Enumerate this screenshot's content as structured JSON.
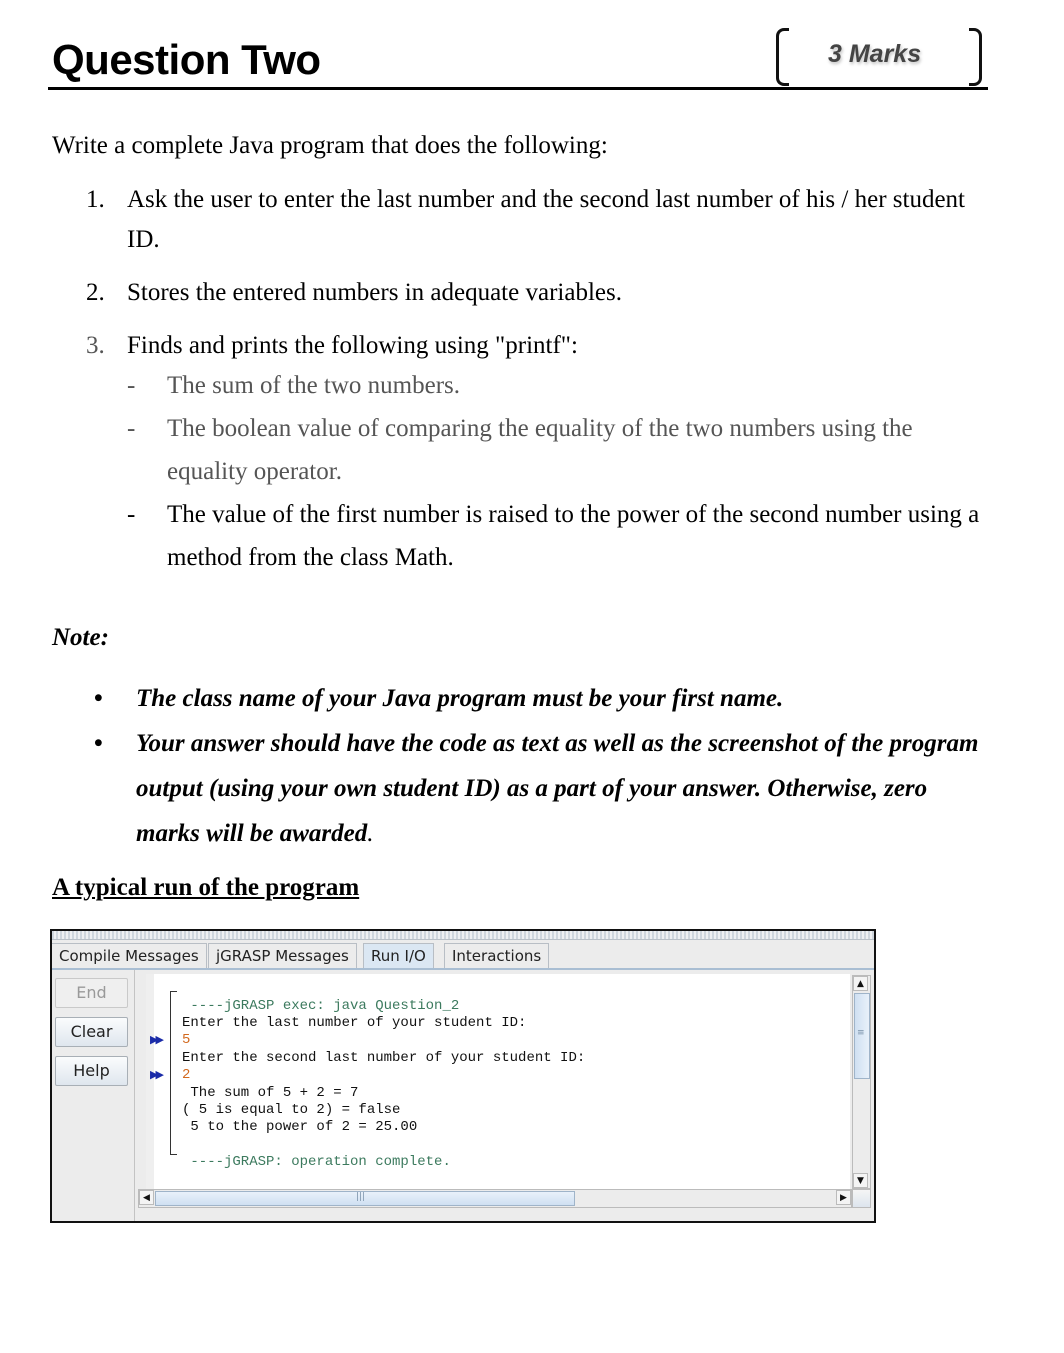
{
  "header": {
    "title": "Question Two",
    "marks": "3 Marks"
  },
  "intro": "Write a complete Java program that does the following:",
  "tasks": [
    {
      "number": "1.",
      "text": "Ask the user to enter the last number and the second last number of his / her student ID."
    },
    {
      "number": "2.",
      "text": "Stores the entered numbers in adequate variables."
    },
    {
      "number": "3.",
      "text": "Finds and prints the following using \"printf\":",
      "subitems": [
        {
          "marker": "-",
          "text": "The sum of the two numbers."
        },
        {
          "marker": "-",
          "text": "The boolean value of comparing the equality of the two numbers using the equality operator."
        },
        {
          "marker": "-",
          "text": "The value of the first number is raised to the power of the second number using a method from the class Math."
        }
      ]
    }
  ],
  "note": {
    "label": "Note:",
    "items": [
      {
        "bullet": "•",
        "text": "The class name of your Java program must be your first name."
      },
      {
        "bullet": "•",
        "text": "Your answer should have the code as text as well as the screenshot of the program output (using your own student ID) as a part of your answer. Otherwise, zero marks will be awarded",
        "end": "."
      }
    ]
  },
  "run_heading": "A typical run of the program",
  "jgrasp": {
    "tabs": [
      {
        "label": "Compile Messages",
        "active": false
      },
      {
        "label": "jGRASP Messages",
        "active": false
      },
      {
        "label": "Run I/O",
        "active": true
      },
      {
        "label": "Interactions",
        "active": false
      }
    ],
    "buttons": {
      "end": "End",
      "clear": "Clear",
      "help": "Help"
    },
    "console_lines": [
      {
        "text": " ----jGRASP exec: java Question_2",
        "kind": "sys"
      },
      {
        "text": "Enter the last number of your student ID:",
        "kind": "out"
      },
      {
        "text": "5",
        "kind": "input"
      },
      {
        "text": "Enter the second last number of your student ID:",
        "kind": "out"
      },
      {
        "text": "2",
        "kind": "input"
      },
      {
        "text": " The sum of 5 + 2 = 7",
        "kind": "out"
      },
      {
        "text": "( 5 is equal to 2) = false",
        "kind": "out"
      },
      {
        "text": " 5 to the power of 2 = 25.00",
        "kind": "out"
      },
      {
        "text": "",
        "kind": "out"
      },
      {
        "text": " ----jGRASP: operation complete.",
        "kind": "sys"
      }
    ],
    "input_marker": "▶▶",
    "scroll_icons": {
      "up": "▲",
      "down": "▼",
      "left": "◀",
      "right": "▶",
      "grip_v": "≡",
      "grip_h": "|||"
    },
    "colors": {
      "system_text": "#3c7a5e",
      "input_text": "#d2691e",
      "marker": "#1a2ba8",
      "active_tab": "#dbe7f3"
    }
  }
}
